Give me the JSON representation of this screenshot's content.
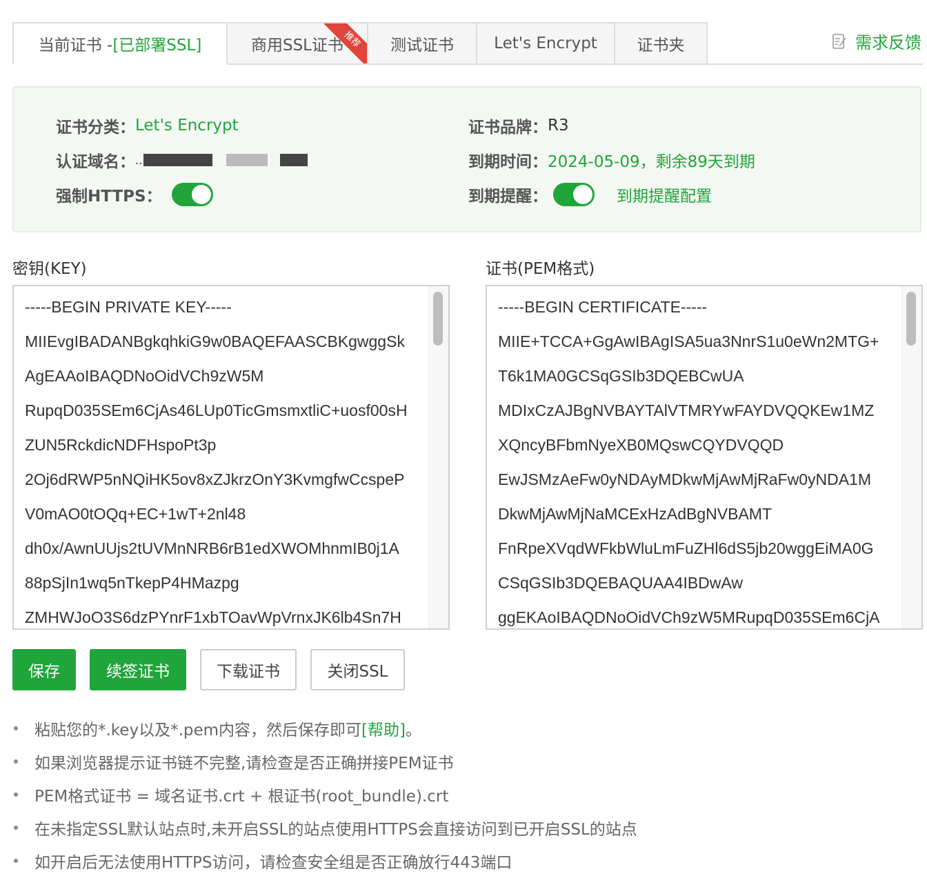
{
  "tabs": {
    "current_prefix": "当前证书 - ",
    "current_status": "[已部署SSL]",
    "commercial": "商用SSL证书",
    "commercial_badge": "推荐",
    "test": "测试证书",
    "letsencrypt": "Let's Encrypt",
    "folder": "证书夹"
  },
  "feedback": {
    "label": "需求反馈",
    "icon": "edit-note-icon"
  },
  "info": {
    "category_label": "证书分类：",
    "category_value": "Let's Encrypt",
    "domain_label": "认证域名：",
    "domain_value_prefix": "..",
    "https_label": "强制HTTPS：",
    "https_enabled": true,
    "brand_label": "证书品牌：",
    "brand_value": "R3",
    "expire_label": "到期时间：",
    "expire_value": "2024-05-09，剩余89天到期",
    "reminder_label": "到期提醒：",
    "reminder_enabled": true,
    "reminder_config_link": "到期提醒配置"
  },
  "key": {
    "title": "密钥(KEY)",
    "lines": [
      "-----BEGIN PRIVATE KEY-----",
      "MIIEvgIBADANBgkqhkiG9w0BAQEFAASCBKgwggSk",
      "AgEAAoIBAQDNoOidVCh9zW5M",
      "RupqD035SEm6CjAs46LUp0TicGmsmxtliC+uosf00sH",
      "ZUN5RckdicNDFHspoPt3p",
      "2Oj6dRWP5nNQiHK5ov8xZJkrzOnY3KvmgfwCcspeP",
      "V0mAO0tOQq+EC+1wT+2nl48",
      "dh0x/AwnUUjs2tUVMnNRB6rB1edXWOMhnmIB0j1A",
      "88pSjIn1wq5nTkepP4HMazpg",
      "ZMHWJoO3S6dzPYnrF1xbTOavWpVrnxJK6lb4Sn7H"
    ]
  },
  "cert": {
    "title": "证书(PEM格式)",
    "lines": [
      "-----BEGIN CERTIFICATE-----",
      "MIIE+TCCA+GgAwIBAgISA5ua3NnrS1u0eWn2MTG+",
      "T6k1MA0GCSqGSIb3DQEBCwUA",
      "MDIxCzAJBgNVBAYTAlVTMRYwFAYDVQQKEw1MZ",
      "XQncyBFbmNyeXB0MQswCQYDVQQD",
      "EwJSMzAeFw0yNDAyMDkwMjAwMjRaFw0yNDA1M",
      "DkwMjAwMjNaMCExHzAdBgNVBAMT",
      "FnRpeXVqdWFkbWluLmFuZHl6dS5jb20wggEiMA0G",
      "CSqGSIb3DQEBAQUAA4IBDwAw",
      "ggEKAoIBAQDNoOidVCh9zW5MRupqD035SEm6CjA"
    ]
  },
  "buttons": {
    "save": "保存",
    "renew": "续签证书",
    "download": "下载证书",
    "close_ssl": "关闭SSL"
  },
  "tips": {
    "tip1_text": "粘贴您的*.key以及*.pem内容，然后保存即可",
    "tip1_link": "[帮助]",
    "tip1_end": "。",
    "tip2": "如果浏览器提示证书链不完整,请检查是否正确拼接PEM证书",
    "tip3": "PEM格式证书 = 域名证书.crt + 根证书(root_bundle).crt",
    "tip4": "在未指定SSL默认站点时,未开启SSL的站点使用HTTPS会直接访问到已开启SSL的站点",
    "tip5": "如开启后无法使用HTTPS访问，请检查安全组是否正确放行443端口"
  },
  "colors": {
    "accent": "#20a53a",
    "badge": "#e0443a"
  }
}
